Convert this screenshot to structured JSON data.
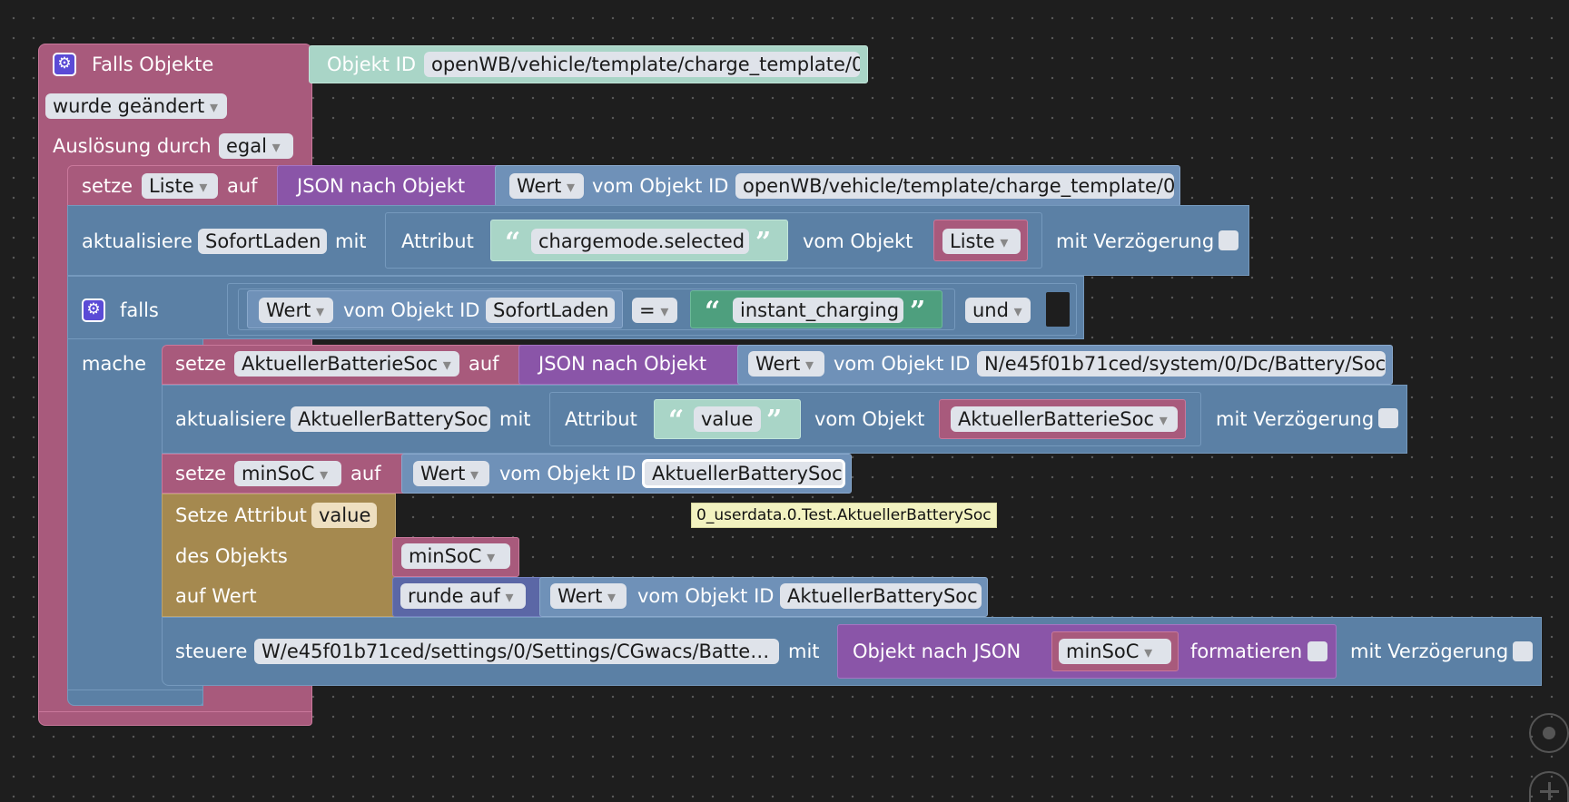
{
  "trigger": {
    "title": "Falls Objekte",
    "object_label": "Objekt ID",
    "object_id": "openWB/vehicle/template/charge_template/0",
    "event": "wurde geändert",
    "triggered_by_label": "Auslösung durch",
    "triggered_by": "egal"
  },
  "set_liste": {
    "verb": "setze",
    "var": "Liste",
    "auf": "auf",
    "json_label": "JSON nach Objekt",
    "wert": "Wert",
    "vom_label": "vom Objekt ID",
    "object_id": "openWB/vehicle/template/charge_template/0"
  },
  "update_sofort": {
    "verb": "aktualisiere",
    "target": "SofortLaden",
    "mit": "mit",
    "attr_label": "Attribut",
    "attr": "chargemode.selected",
    "vom_obj_label": "vom Objekt",
    "obj": "Liste",
    "delay_label": "mit Verzögerung"
  },
  "if_block": {
    "falls": "falls",
    "mache": "mache",
    "wert": "Wert",
    "vom_label": "vom Objekt ID",
    "obj": "SofortLaden",
    "op": "=",
    "text": "instant_charging",
    "logic": "und"
  },
  "set_batt": {
    "verb": "setze",
    "var": "AktuellerBatterieSoc",
    "auf": "auf",
    "json_label": "JSON nach Objekt",
    "wert": "Wert",
    "vom_label": "vom Objekt ID",
    "object_id": "N/e45f01b71ced/system/0/Dc/Battery/Soc"
  },
  "update_batt": {
    "verb": "aktualisiere",
    "target": "AktuellerBatterySoc",
    "mit": "mit",
    "attr_label": "Attribut",
    "attr": "value",
    "vom_obj_label": "vom Objekt",
    "obj": "AktuellerBatterieSoc",
    "delay_label": "mit Verzögerung"
  },
  "set_minsoc": {
    "verb": "setze",
    "var": "minSoC",
    "auf": "auf",
    "wert": "Wert",
    "vom_label": "vom Objekt ID",
    "obj": "AktuellerBatterySoc"
  },
  "tooltip": "0_userdata.0.Test.AktuellerBatterySoc",
  "set_attr": {
    "label": "Setze Attribut",
    "attr": "value",
    "des_label": "des Objekts",
    "obj": "minSoC",
    "auf_label": "auf Wert",
    "round": "runde auf",
    "wert": "Wert",
    "vom_label": "vom Objekt ID",
    "source": "AktuellerBatterySoc"
  },
  "control": {
    "verb": "steuere",
    "target": "W/e45f01b71ced/settings/0/Settings/CGwacs/Batter…",
    "mit": "mit",
    "json_label": "Objekt nach JSON",
    "obj": "minSoC",
    "format_label": "formatieren",
    "delay_label": "mit Verzögerung"
  },
  "colors": {
    "event": "#a85a7c",
    "logic": "#5b80a5",
    "json": "#8a55a8",
    "value": "#6f91b8",
    "text": "#a9d5c7",
    "attribute": "#a5894f",
    "math": "#5b67a6"
  }
}
